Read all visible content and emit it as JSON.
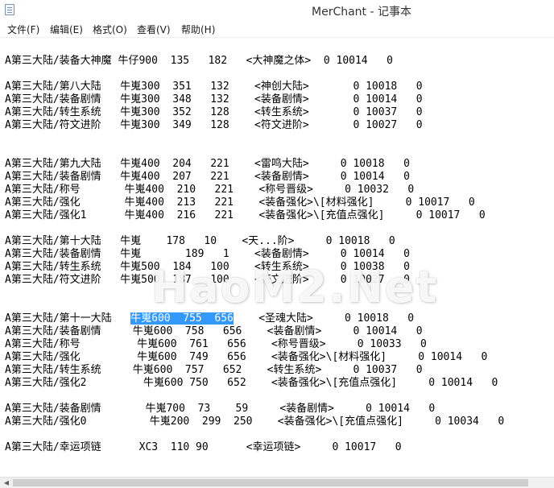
{
  "window": {
    "title": "MerChant - 记事本",
    "icon": "notepad-icon"
  },
  "menu": [
    "文件(F)",
    "编辑(E)",
    "格式(O)",
    "查看(V)",
    "帮助(H)"
  ],
  "watermark": "HaoM2.Net",
  "selection": {
    "color": "#3399ff"
  },
  "lines": [
    {
      "id": 1,
      "text": "A第三大陆/装备大神魔 牛仔900  135   182   <大神魔之体>  0 10014   0"
    },
    {
      "id": 2,
      "text": "A第三大陆/第八大陆   牛嵬300  351   132    <神创大陆>       0 10018   0"
    },
    {
      "id": 3,
      "text": "A第三大陆/装备剧情   牛嵬300  348   132    <装备剧情>       0 10014   0"
    },
    {
      "id": 4,
      "text": "A第三大陆/转生系统   牛嵬300  352   128    <转生系统>       0 10037   0"
    },
    {
      "id": 5,
      "text": "A第三大陆/符文进阶   牛嵬300  349   128    <符文进阶>       0 10027   0"
    },
    {
      "id": 6,
      "text": "A第三大陆/第九大陆   牛嵬400  204   221    <雷鸣大陆>     0 10018   0"
    },
    {
      "id": 7,
      "text": "A第三大陆/装备剧情   牛嵬400  207   221    <装备剧情>     0 10014   0"
    },
    {
      "id": 8,
      "text": "A第三大陆/称号       牛嵬400  210   221    <称号晋级>     0 10032   0"
    },
    {
      "id": 9,
      "text": "A第三大陆/强化       牛嵬400  213   221    <装备强化>\\[材料强化]     0 10017   0"
    },
    {
      "id": 10,
      "text": "A第三大陆/强化1      牛嵬400  216   221    <装备强化>\\[充值点强化]     0 10017   0"
    },
    {
      "id": 11,
      "text": "A第三大陆/第十大陆   牛嵬    178   10    <天...阶>     0 10018   0"
    },
    {
      "id": 12,
      "text": "A第三大陆/装备剧情   牛嵬       189   1    <装备剧情>     0 10014   0"
    },
    {
      "id": 13,
      "text": "A第三大陆/转生系统   牛嵬500  184   100    <转生系统>     0 10038   0"
    },
    {
      "id": 14,
      "text": "A第三大陆/符文进阶   牛嵬500  187   100    <符文进阶>     0 10027   0"
    },
    {
      "id": 15,
      "prefix": "A第三大陆/第十一大陆   ",
      "selected": "牛嵬600  755  656",
      "suffix": "    <圣魂大陆>     0 10018   0"
    },
    {
      "id": 16,
      "text": "A第三大陆/装备剧情     牛嵬600  758   656    <装备剧情>     0 10014   0"
    },
    {
      "id": 17,
      "text": "A第三大陆/称号         牛嵬600  761   656    <称号晋级>     0 10033   0"
    },
    {
      "id": 18,
      "text": "A第三大陆/强化         牛嵬600  749   656    <装备强化>\\[材料强化]     0 10014   0"
    },
    {
      "id": 19,
      "text": "A第三大陆/转生系统     牛嵬600  757   652    <转生系统>     0 10037   0"
    },
    {
      "id": 20,
      "text": "A第三大陆/强化2         牛嵬600 750   652    <装备强化>\\[充值点强化]     0 10014   0"
    },
    {
      "id": 21,
      "text": "A第三大陆/装备剧情       牛嵬700  73    59     <装备剧情>     0 10014   0"
    },
    {
      "id": 22,
      "text": "A第三大陆/强化0          牛嵬200  299  250    <装备强化>\\[充值点强化]     0 10034   0"
    },
    {
      "id": 23,
      "text": "A第三大陆/幸运项链      XC3  110 90      <幸运项链>     0 10017   0"
    }
  ]
}
